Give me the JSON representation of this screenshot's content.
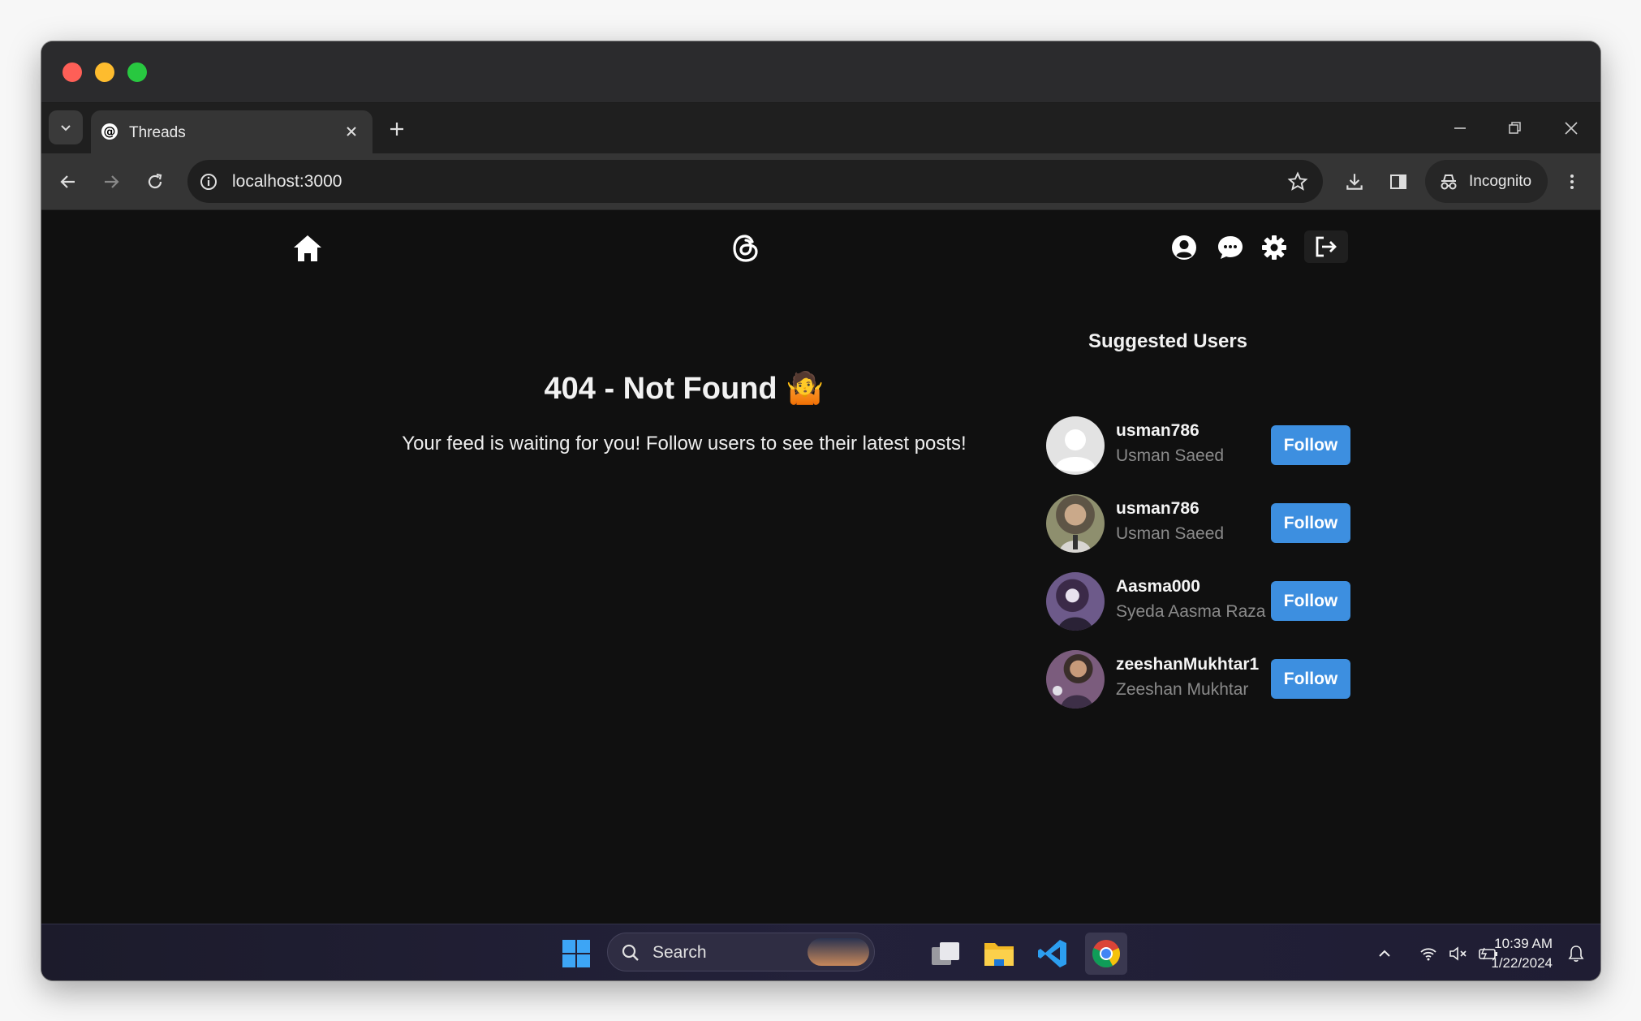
{
  "browser": {
    "tab_title": "Threads",
    "url": "localhost:3000",
    "incognito_label": "Incognito"
  },
  "nav": {
    "icons": [
      "home-icon",
      "threads-logo-icon",
      "user-profile-icon",
      "chat-icon",
      "settings-icon",
      "logout-icon"
    ]
  },
  "main": {
    "heading": "404 - Not Found 🤷",
    "message": "Your feed is waiting for you! Follow users to see their latest posts!"
  },
  "suggested": {
    "title": "Suggested Users",
    "users": [
      {
        "username": "usman786",
        "name": "Usman Saeed",
        "button": "Follow"
      },
      {
        "username": "usman786",
        "name": "Usman Saeed",
        "button": "Follow"
      },
      {
        "username": "Aasma000",
        "name": "Syeda Aasma Raza",
        "button": "Follow"
      },
      {
        "username": "zeeshanMukhtar1",
        "name": "Zeeshan Mukhtar",
        "button": "Follow"
      }
    ]
  },
  "taskbar": {
    "search_label": "Search",
    "time": "10:39 AM",
    "date": "1/22/2024"
  },
  "colors": {
    "page_bg": "#101010",
    "follow_button": "#3d8fe0",
    "muted_text": "#8a8a8a"
  }
}
